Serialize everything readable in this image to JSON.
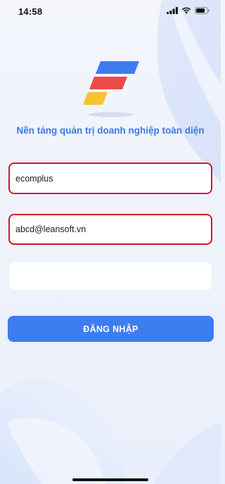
{
  "status_bar": {
    "time": "14:58",
    "icons": [
      "signal-icon",
      "wifi-icon",
      "battery-icon"
    ]
  },
  "branding": {
    "logo": "app-logo",
    "tagline": "Nền tảng quản trị doanh nghiệp toàn diện",
    "colors": {
      "blue": "#3d7cf1",
      "red": "#ef4a4a",
      "yellow": "#f7c232",
      "tagline": "#3b78e6"
    }
  },
  "form": {
    "username": {
      "value": "ecomplus"
    },
    "email": {
      "value": "abcd@leansoft.vn"
    },
    "password": {
      "value": ""
    },
    "highlight_color": "#d6142a"
  },
  "login_button": {
    "label": "ĐĂNG NHẬP",
    "color": "#3d7cf1"
  }
}
